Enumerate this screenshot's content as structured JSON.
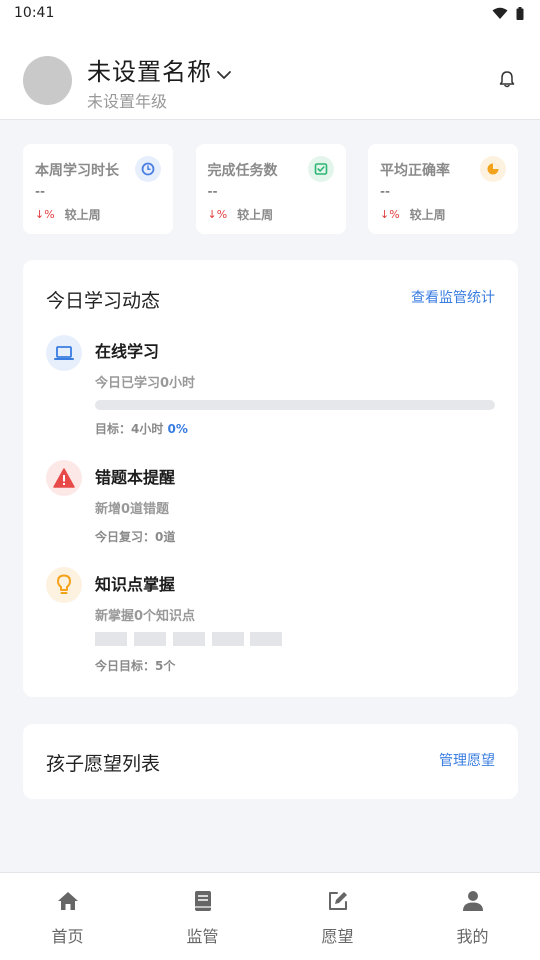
{
  "status_bar": {
    "time": "10:41"
  },
  "profile": {
    "name": "未设置名称",
    "grade": "未设置年级"
  },
  "stats": [
    {
      "title": "本周学习时长",
      "value": "--",
      "change": "%",
      "compare": "较上周",
      "icon": "clock-icon",
      "color": "#4a7fe3",
      "bg": "#e8effc"
    },
    {
      "title": "完成任务数",
      "value": "--",
      "change": "%",
      "compare": "较上周",
      "icon": "task-check-icon",
      "color": "#2bb673",
      "bg": "#e4f6ec"
    },
    {
      "title": "平均正确率",
      "value": "--",
      "change": "%",
      "compare": "较上周",
      "icon": "pie-chart-icon",
      "color": "#f3a21b",
      "bg": "#fdf2e0"
    }
  ],
  "today": {
    "title": "今日学习动态",
    "link": "查看监管统计",
    "online": {
      "title": "在线学习",
      "sub": "今日已学习0小时",
      "goal_prefix": "目标：4小时 ",
      "percent": "0%",
      "progress": 0
    },
    "mistakes": {
      "title": "错题本提醒",
      "sub": "新增0道错题",
      "meta": "今日复习：0道"
    },
    "knowledge": {
      "title": "知识点掌握",
      "sub": "新掌握0个知识点",
      "meta": "今日目标：5个"
    }
  },
  "wishes": {
    "title": "孩子愿望列表",
    "link": "管理愿望"
  },
  "tabs": [
    {
      "label": "首页",
      "icon": "home-icon"
    },
    {
      "label": "监管",
      "icon": "book-icon"
    },
    {
      "label": "愿望",
      "icon": "edit-icon"
    },
    {
      "label": "我的",
      "icon": "user-icon"
    }
  ],
  "colors": {
    "accent": "#3a7de0",
    "down": "#e03c3c",
    "warning": "#e84a4a",
    "bulb": "#f3a21b"
  }
}
